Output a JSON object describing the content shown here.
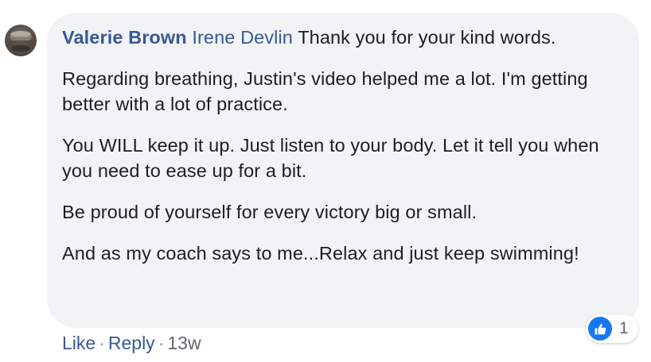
{
  "comment": {
    "author": "Valerie Brown",
    "mention": "Irene Devlin",
    "first_line_text": " Thank you for your kind words.",
    "paragraphs": [
      "Regarding breathing, Justin's video helped me a lot. I'm getting better with a lot of practice.",
      "You WILL keep it up. Just listen to your body. Let it tell you when you need to ease up for a bit.",
      "Be proud of yourself for every victory big or small.",
      "And as my coach says to me...Relax and just keep swimming!"
    ]
  },
  "actions": {
    "like_label": "Like",
    "separator": "·",
    "reply_label": "Reply",
    "timestamp": "13w"
  },
  "reactions": {
    "icon": "thumbs-up-icon",
    "count": "1"
  },
  "colors": {
    "bubble_bg": "#f2f3f5",
    "link": "#385898",
    "text": "#1c1e21",
    "meta": "#606770",
    "like_blue": "#1877f2"
  }
}
